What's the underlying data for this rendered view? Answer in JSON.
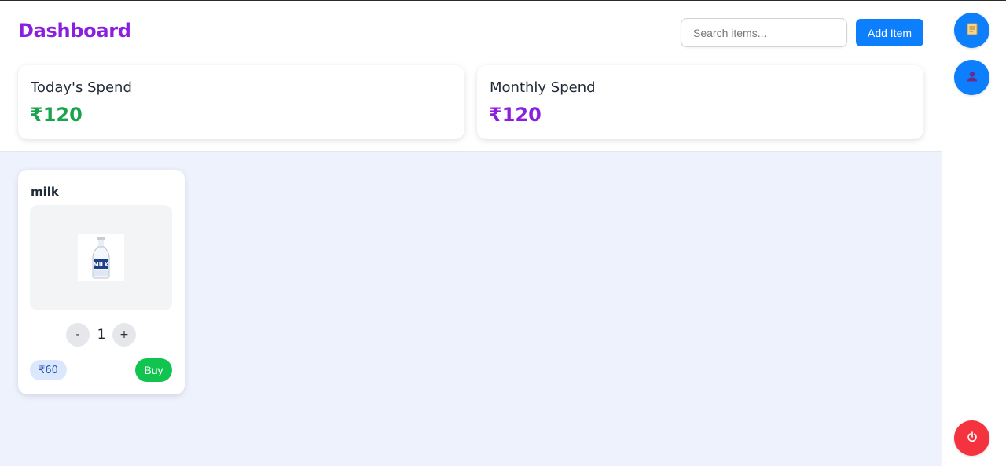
{
  "header": {
    "title": "Dashboard",
    "search_placeholder": "Search items...",
    "add_item_label": "Add Item"
  },
  "stats": {
    "today": {
      "label": "Today's Spend",
      "value": "₹120"
    },
    "monthly": {
      "label": "Monthly Spend",
      "value": "₹120"
    }
  },
  "items": [
    {
      "name": "milk",
      "quantity": "1",
      "minus_label": "-",
      "plus_label": "+",
      "price": "₹60",
      "buy_label": "Buy",
      "image_icon": "milk-bottle-icon"
    }
  ],
  "rail": {
    "buttons": [
      {
        "icon": "receipt-icon"
      },
      {
        "icon": "user-icon"
      },
      {
        "icon": "power-icon"
      }
    ]
  },
  "colors": {
    "title": "#8a1fe0",
    "accent_blue": "#0d7ffc",
    "today_value": "#19a34a",
    "monthly_value": "#8a1fe0",
    "buy_green": "#11c34f",
    "logout_red": "#f5333f",
    "content_bg": "#eef2fd"
  }
}
